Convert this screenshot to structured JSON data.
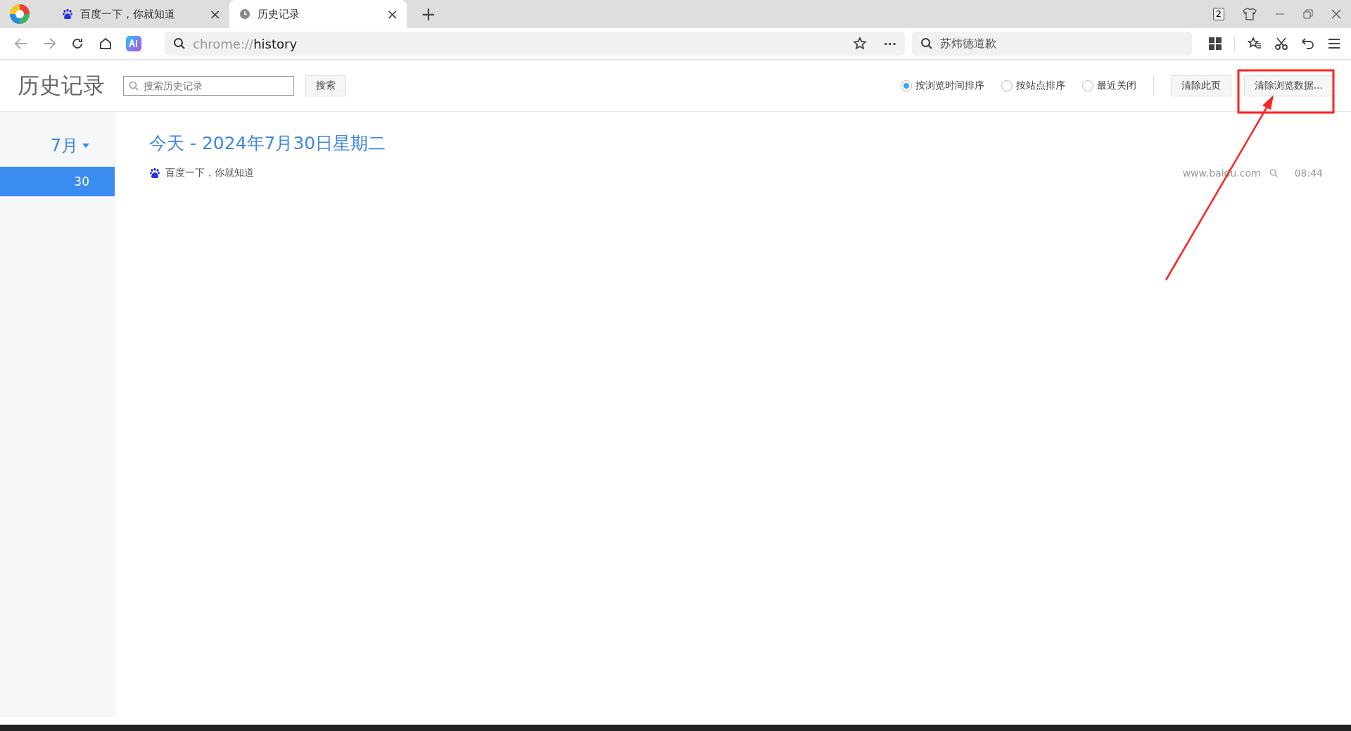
{
  "browser": {
    "tabs": [
      {
        "title": "百度一下，你就知道",
        "kind": "site",
        "selected": false,
        "close": "×"
      },
      {
        "title": "历史记录",
        "kind": "history",
        "selected": true,
        "close": "×"
      }
    ],
    "new_tab": "+",
    "tab_count": "2",
    "address": {
      "scheme": "chrome://",
      "path": "history"
    },
    "more": "···",
    "search": {
      "value": "苏炜德道歉"
    }
  },
  "header": {
    "title": "历史记录",
    "search": {
      "placeholder": "搜索历史记录"
    },
    "search_button": "搜索",
    "sort_options": [
      {
        "label": "按浏览时间排序",
        "selected": true
      },
      {
        "label": "按站点排序",
        "selected": false
      },
      {
        "label": "最近关闭",
        "selected": false
      }
    ],
    "buttons": [
      "清除此页",
      "清除浏览数据..."
    ]
  },
  "sidebar": {
    "month": "7月",
    "days": [
      {
        "label": "30",
        "selected": true
      }
    ]
  },
  "days": [
    {
      "heading": "今天 - 2024年7月30日星期二",
      "entries": [
        {
          "title": "百度一下，你就知道",
          "domain": "www.baidu.com",
          "time": "08:44"
        }
      ]
    }
  ],
  "annotation": {
    "kind": "highlight"
  }
}
